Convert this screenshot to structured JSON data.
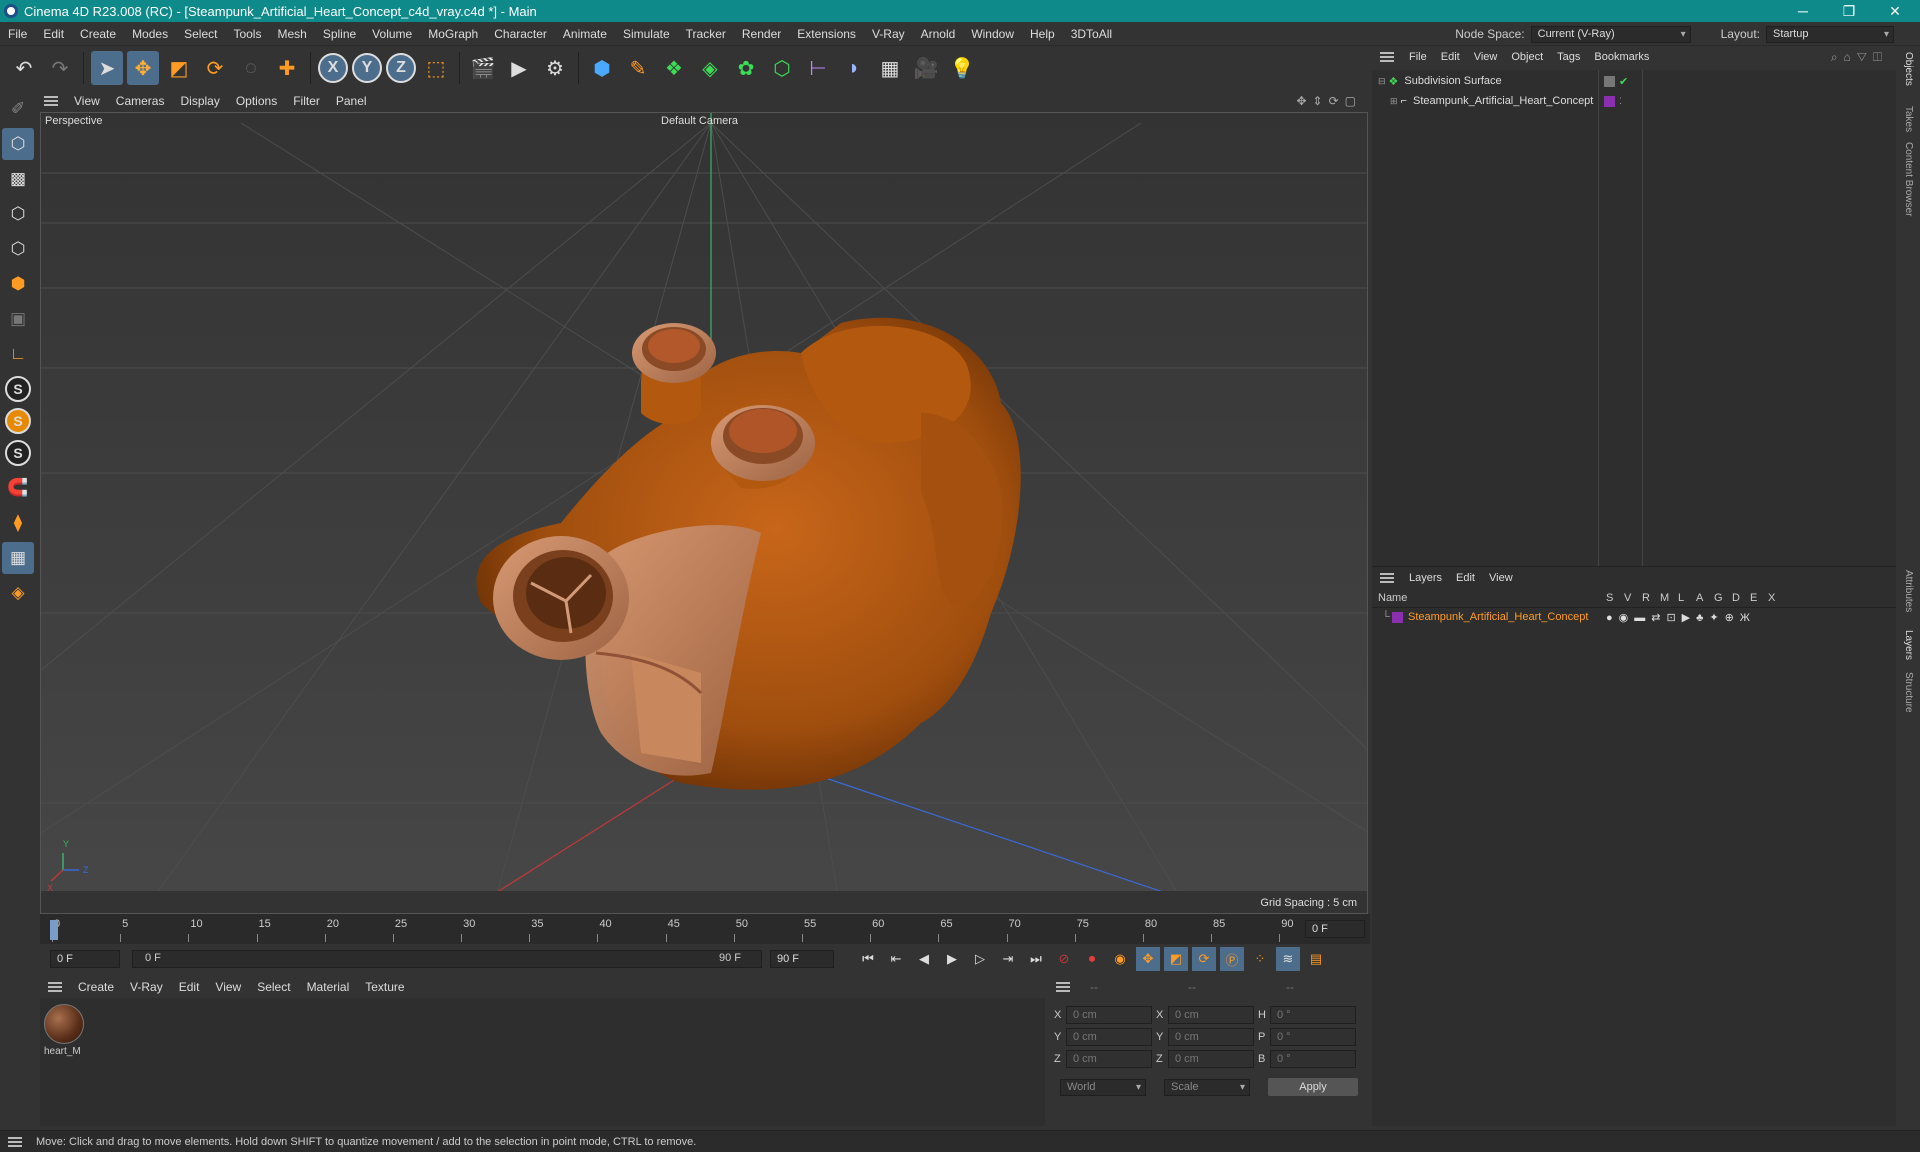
{
  "title": "Cinema 4D R23.008 (RC) - [Steampunk_Artificial_Heart_Concept_c4d_vray.c4d *] - Main",
  "window_controls": {
    "minimize": "─",
    "maximize": "❐",
    "close": "✕"
  },
  "menu": [
    "File",
    "Edit",
    "Create",
    "Modes",
    "Select",
    "Tools",
    "Mesh",
    "Spline",
    "Volume",
    "MoGraph",
    "Character",
    "Animate",
    "Simulate",
    "Tracker",
    "Render",
    "Extensions",
    "V-Ray",
    "Arnold",
    "Window",
    "Help",
    "3DToAll"
  ],
  "node_space": {
    "label": "Node Space:",
    "value": "Current (V-Ray)"
  },
  "layout": {
    "label": "Layout:",
    "value": "Startup"
  },
  "viewport": {
    "menu": [
      "View",
      "Cameras",
      "Display",
      "Options",
      "Filter",
      "Panel"
    ],
    "view_name": "Perspective",
    "camera": "Default Camera",
    "grid_spacing": "Grid Spacing : 5 cm",
    "axis": {
      "y": "Y",
      "x": "X",
      "z": "Z"
    }
  },
  "timeline": {
    "ticks": [
      "0",
      "5",
      "10",
      "15",
      "20",
      "25",
      "30",
      "35",
      "40",
      "45",
      "50",
      "55",
      "60",
      "65",
      "70",
      "75",
      "80",
      "85",
      "90"
    ],
    "current_frame": "0 F"
  },
  "transport": {
    "start": "0 F",
    "range_start": "0 F",
    "range_end": "90 F",
    "end": "90 F"
  },
  "material_menu": [
    "Create",
    "V-Ray",
    "Edit",
    "View",
    "Select",
    "Material",
    "Texture"
  ],
  "material": {
    "name": "heart_M"
  },
  "coords": {
    "headers": [
      "--",
      "--",
      "--"
    ],
    "rows": [
      {
        "a": "X",
        "av": "0 cm",
        "b": "X",
        "bv": "0 cm",
        "c": "H",
        "cv": "0 °"
      },
      {
        "a": "Y",
        "av": "0 cm",
        "b": "Y",
        "bv": "0 cm",
        "c": "P",
        "cv": "0 °"
      },
      {
        "a": "Z",
        "av": "0 cm",
        "b": "Z",
        "bv": "0 cm",
        "c": "B",
        "cv": "0 °"
      }
    ],
    "mode1": "World",
    "mode2": "Scale",
    "apply": "Apply"
  },
  "objects_menu": [
    "File",
    "Edit",
    "View",
    "Object",
    "Tags",
    "Bookmarks"
  ],
  "objects": [
    {
      "name": "Subdivision Surface"
    },
    {
      "name": "Steampunk_Artificial_Heart_Concept"
    }
  ],
  "layers_menu": [
    "Layers",
    "Edit",
    "View"
  ],
  "layers_header": {
    "name": "Name",
    "flags": [
      "S",
      "V",
      "R",
      "M",
      "L",
      "A",
      "G",
      "D",
      "E",
      "X"
    ]
  },
  "layers": [
    {
      "name": "Steampunk_Artificial_Heart_Concept"
    }
  ],
  "side_tabs": [
    "Objects",
    "Takes",
    "Content Browser",
    "Attributes",
    "Layers",
    "Structure"
  ],
  "status": "Move: Click and drag to move elements. Hold down SHIFT to quantize movement / add to the selection in point mode, CTRL to remove.",
  "colors": {
    "accent": "#0e8a8a",
    "layer_color": "#8a2fb0",
    "selection": "#4d6d8c",
    "heart": "#b35a12"
  }
}
